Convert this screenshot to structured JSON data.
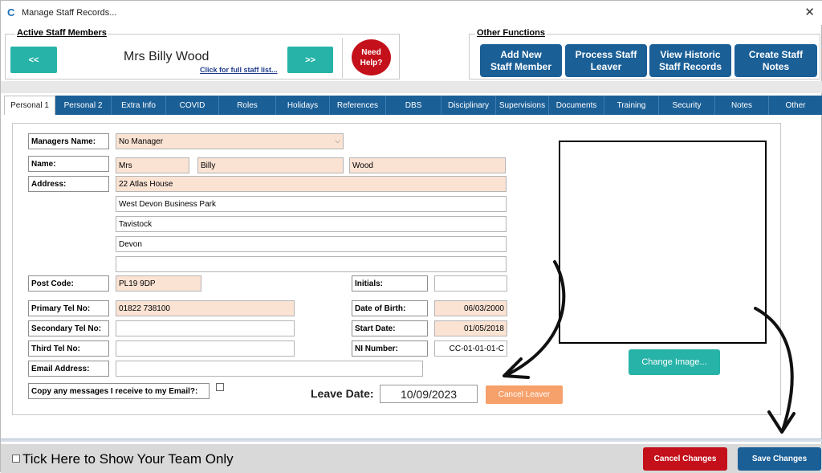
{
  "window": {
    "title": "Manage Staff Records...",
    "close_glyph": "✕",
    "app_icon": "c-logo-icon"
  },
  "header": {
    "active_staff_label": "Active Staff Members",
    "prev_label": "<<",
    "next_label": ">>",
    "staff_name": "Mrs Billy Wood",
    "full_list_link": "Click for full staff list...",
    "need_help_line1": "Need",
    "need_help_line2": "Help?",
    "other_functions_label": "Other Functions",
    "functions": [
      {
        "line1": "Add New",
        "line2": "Staff Member"
      },
      {
        "line1": "Process Staff",
        "line2": "Leaver"
      },
      {
        "line1": "View Historic",
        "line2": "Staff Records"
      },
      {
        "line1": "Create Staff",
        "line2": "Notes"
      }
    ]
  },
  "tabs": [
    "Personal 1",
    "Personal 2",
    "Extra Info",
    "COVID",
    "Roles",
    "Holidays",
    "References",
    "DBS",
    "Disciplinary",
    "Supervisions",
    "Documents",
    "Training",
    "Security",
    "Notes",
    "Other"
  ],
  "form": {
    "labels": {
      "managers_name": "Managers Name:",
      "name": "Name:",
      "address": "Address:",
      "post_code": "Post Code:",
      "initials": "Initials:",
      "primary_tel": "Primary Tel No:",
      "date_of_birth": "Date of Birth:",
      "secondary_tel": "Secondary Tel No:",
      "start_date": "Start Date:",
      "third_tel": "Third Tel No:",
      "ni_number": "NI Number:",
      "email": "Email Address:",
      "copy_messages": "Copy any messages I receive to my Email?:"
    },
    "values": {
      "manager": "No Manager",
      "title": "Mrs",
      "first_name": "Billy",
      "last_name": "Wood",
      "address1": "22 Atlas House",
      "address2": "West Devon Business Park",
      "address3": "Tavistock",
      "address4": "Devon",
      "address5": "",
      "post_code": "PL19 9DP",
      "initials": "",
      "primary_tel": "01822 738100",
      "date_of_birth": "06/03/2000",
      "secondary_tel": "",
      "start_date": "01/05/2018",
      "third_tel": "",
      "ni_number": "CC-01-01-01-C",
      "email": ""
    },
    "copy_messages_checked": false
  },
  "photo": {
    "change_image_label": "Change Image..."
  },
  "leave": {
    "label": "Leave Date:",
    "value": "10/09/2023",
    "cancel_leaver_label": "Cancel Leaver"
  },
  "footer": {
    "team_only_label": "Tick Here to Show Your Team Only",
    "cancel_changes_label": "Cancel Changes",
    "save_changes_label": "Save Changes"
  },
  "colors": {
    "teal": "#27b3a8",
    "blue": "#1b5f97",
    "red": "#c4101a",
    "peach": "#fbe3d4",
    "orange": "#f6a06b"
  }
}
